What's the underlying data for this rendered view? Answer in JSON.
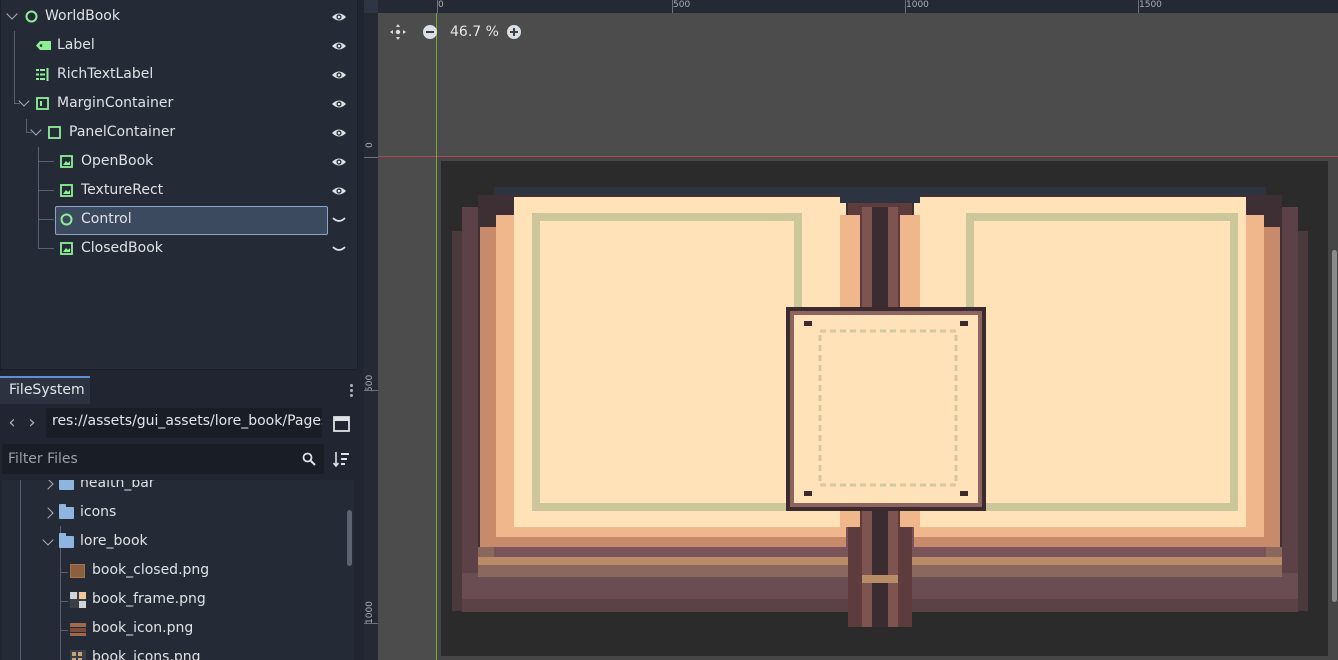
{
  "scene_tree": {
    "nodes": [
      {
        "label": "WorldBook",
        "type": "control-node",
        "depth": 0,
        "expanded": true
      },
      {
        "label": "Label",
        "type": "label-node",
        "depth": 1
      },
      {
        "label": "RichTextLabel",
        "type": "richtextlabel-node",
        "depth": 1
      },
      {
        "label": "MarginContainer",
        "type": "margincontainer-node",
        "depth": 1,
        "expanded": true
      },
      {
        "label": "PanelContainer",
        "type": "panelcontainer-node",
        "depth": 2,
        "expanded": true
      },
      {
        "label": "OpenBook",
        "type": "texturerect-node",
        "depth": 3
      },
      {
        "label": "TextureRect",
        "type": "texturerect-node",
        "depth": 3
      },
      {
        "label": "Control",
        "type": "control-node",
        "depth": 3,
        "selected": true
      },
      {
        "label": "ClosedBook",
        "type": "texturerect-node",
        "depth": 3
      }
    ],
    "visibility": [
      "visible",
      "visible",
      "visible",
      "visible",
      "visible",
      "visible",
      "visible",
      "hidden",
      "hidden"
    ]
  },
  "filesystem": {
    "tab_label": "FileSystem",
    "path": "res://assets/gui_assets/lore_book/Pages",
    "filter_placeholder": "Filter Files",
    "items": [
      {
        "label": "health_bar",
        "kind": "folder",
        "expanded": false
      },
      {
        "label": "icons",
        "kind": "folder",
        "expanded": false
      },
      {
        "label": "lore_book",
        "kind": "folder",
        "expanded": true
      },
      {
        "label": "book_closed.png",
        "kind": "file"
      },
      {
        "label": "book_frame.png",
        "kind": "file"
      },
      {
        "label": "book_icon.png",
        "kind": "file"
      },
      {
        "label": "book_icons.png",
        "kind": "file"
      }
    ]
  },
  "viewport": {
    "zoom_label": "46.7 %",
    "ruler_top_labels": [
      "0",
      "500",
      "1000",
      "1500"
    ],
    "ruler_left_labels": [
      "0",
      "500",
      "1000"
    ]
  },
  "colors": {
    "icon_green": "#8eef97",
    "selection_bg": "#3c4a60",
    "accent_blue": "#5d8fd6",
    "axis_red": "#b0455a",
    "axis_green": "#7ca23a"
  }
}
